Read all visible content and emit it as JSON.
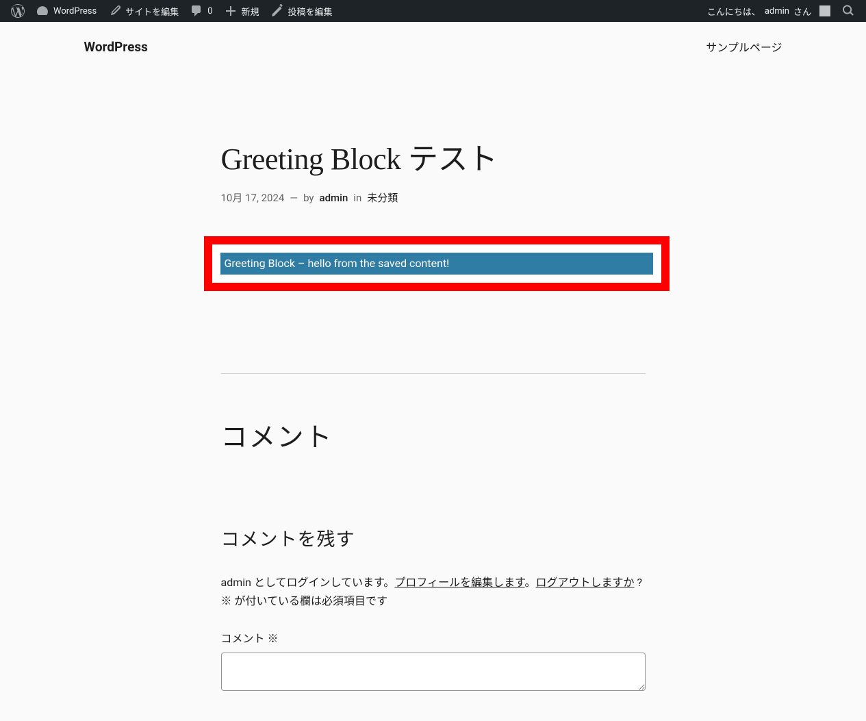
{
  "adminbar": {
    "wordpress_label": "WordPress",
    "edit_site_label": "サイトを編集",
    "comments_count": "0",
    "new_label": "新規",
    "edit_post_label": "投稿を編集",
    "greeting_prefix": "こんにちは、",
    "username": "admin",
    "greeting_suffix": " さん"
  },
  "header": {
    "site_title": "WordPress",
    "nav_sample_page": "サンプルページ"
  },
  "post": {
    "title": "Greeting Block テスト",
    "date": "10月 17, 2024",
    "separator": "—",
    "by_label": "by",
    "author": "admin",
    "in_label": "in",
    "category": "未分類"
  },
  "greeting": {
    "text": "Greeting Block – hello from the saved content!"
  },
  "comments": {
    "heading": "コメント",
    "leave_reply": "コメントを残す",
    "logged_in_prefix": "admin としてログインしています。",
    "edit_profile": "プロフィールを編集します",
    "period": "。",
    "logout": "ログアウトしますか",
    "required_note": " ? ※ が付いている欄は必須項目です",
    "comment_label": "コメント ※"
  }
}
